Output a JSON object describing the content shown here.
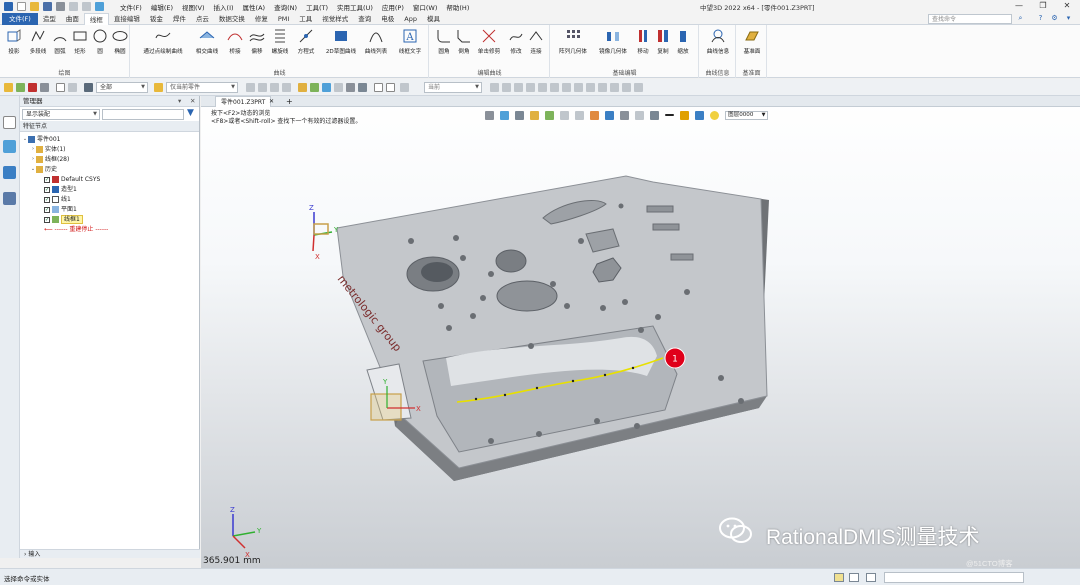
{
  "titlebar": {
    "menus": [
      "文件(F)",
      "编辑(E)",
      "视图(V)",
      "插入(I)",
      "属性(A)",
      "查询(N)",
      "工具(T)",
      "实用工具(U)",
      "应用(P)",
      "窗口(W)",
      "帮助(H)"
    ],
    "app_title": "中望3D 2022 x64 - [零件001.Z3PRT]",
    "controls": {
      "minimize": "—",
      "restore": "❐",
      "close": "✕"
    }
  },
  "ribbon_tabs": [
    "文件(F)",
    "造型",
    "曲面",
    "线框",
    "直接编辑",
    "钣金",
    "焊件",
    "点云",
    "数据交换",
    "修复",
    "PMI",
    "工具",
    "视觉样式",
    "查询",
    "电极",
    "App",
    "模具"
  ],
  "active_tab": "线框",
  "search_placeholder": "查找命令",
  "ribbon": {
    "groups": [
      {
        "label": "绘图",
        "buttons": [
          "投影",
          "多段线",
          "圆弧",
          "矩形",
          "圆",
          "椭圆"
        ]
      },
      {
        "label": "曲线",
        "buttons": [
          "通过点绘制曲线",
          "相交曲线",
          "桥接",
          "偏移",
          "螺旋线",
          "方程式",
          "2D草图曲线",
          "曲线列表",
          "线框文字"
        ]
      },
      {
        "label": "编辑曲线",
        "buttons": [
          "圆角",
          "倒角",
          "单击修剪",
          "修改",
          "连接"
        ]
      },
      {
        "label": "基础编辑",
        "buttons": [
          "阵列几何体",
          "镜像几何体",
          "移动",
          "复制",
          "缩放"
        ]
      },
      {
        "label": "曲线信息",
        "buttons": [
          "曲线信息"
        ]
      },
      {
        "label": "基准面",
        "buttons": [
          "基准面"
        ]
      }
    ]
  },
  "toolbar2": {
    "filter_combo": "全部",
    "scope_combo": "仅当前零件",
    "direction_combo": "当前"
  },
  "manager": {
    "title": "管理器",
    "display_combo": "显示装配",
    "section_header": "特征节点",
    "tree": [
      {
        "label": "零件001",
        "level": 0,
        "expander": "⌄",
        "icon": "part-icon"
      },
      {
        "label": "实体(1)",
        "level": 1,
        "expander": "›",
        "icon": "solid-icon"
      },
      {
        "label": "线框(28)",
        "level": 1,
        "expander": "›",
        "icon": "wireframe-icon"
      },
      {
        "label": "历史",
        "level": 1,
        "expander": "⌄",
        "icon": "history-icon"
      },
      {
        "label": "Default CSYS",
        "level": 2,
        "checked": true,
        "icon": "csys-icon"
      },
      {
        "label": "造型1",
        "level": 2,
        "checked": true,
        "icon": "shape-icon"
      },
      {
        "label": "线1",
        "level": 2,
        "checked": true,
        "icon": "line-icon"
      },
      {
        "label": "平面1",
        "level": 2,
        "checked": true,
        "icon": "plane-icon"
      },
      {
        "label": "线框1",
        "level": 2,
        "checked": true,
        "icon": "wire-icon",
        "selected": true
      }
    ],
    "rebuild_stop": "------ 重建停止 ------",
    "bottom_section": "输入"
  },
  "viewport": {
    "tab_label": "零件001.Z3PRT",
    "add_tab": "+",
    "prompt_lines": [
      "按下<F2>动态的浏览",
      "<F8>或者<Shift-roll> 查找下一个有效的过滤器设置。"
    ],
    "layer_combo": "图层0000",
    "part_text": "metrologic group",
    "marker_label": "1",
    "distance_readout": "365.901 mm",
    "watermark": "RationalDMIS测量技术",
    "credit": "@51CTO博客"
  },
  "status": {
    "text": "选择命令或实体"
  },
  "colors": {
    "accent": "#2b65b1",
    "curve": "#e8e000",
    "marker": "#e0001a",
    "logo_text": "#7a2b2b"
  }
}
